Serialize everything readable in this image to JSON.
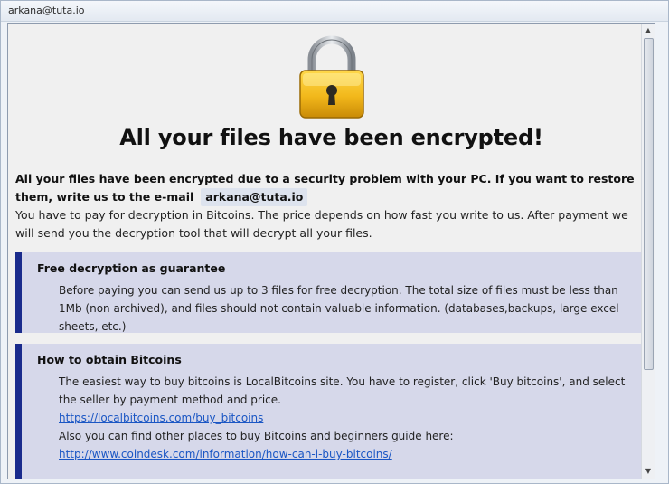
{
  "window": {
    "title": "arkana@tuta.io"
  },
  "header": {
    "headline": "All your files have been encrypted!"
  },
  "intro": {
    "bold_text": "All your files have been encrypted due to a security problem with your PC. If you want to restore them, write us to the e-mail",
    "email": "arkana@tuta.io",
    "paragraph": "You have to pay for decryption in Bitcoins. The price depends on how fast you write to us. After payment we will send you the decryption tool that will decrypt all your files."
  },
  "sections": [
    {
      "title": "Free decryption as guarantee",
      "body": "Before paying you can send us up to 3 files for free decryption. The total size of files must be less than 1Mb (non archived), and files should not contain valuable information. (databases,backups, large excel sheets, etc.)"
    },
    {
      "title": "How to obtain Bitcoins",
      "body1": "The easiest way to buy bitcoins is LocalBitcoins site. You have to register, click 'Buy bitcoins', and select the seller by payment method and price.",
      "link1": "https://localbitcoins.com/buy_bitcoins",
      "body2": "Also you can find other places to buy Bitcoins and beginners guide here:",
      "link2": "http://www.coindesk.com/information/how-can-i-buy-bitcoins/"
    }
  ],
  "icons": {
    "lock": "padlock-icon",
    "scroll_up": "scroll-up-arrow",
    "scroll_down": "scroll-down-arrow"
  },
  "colors": {
    "section_background": "#d6d8ea",
    "section_accent": "#1a2b8c",
    "link": "#1a56c4",
    "lock_gold": "#f2b81b"
  }
}
